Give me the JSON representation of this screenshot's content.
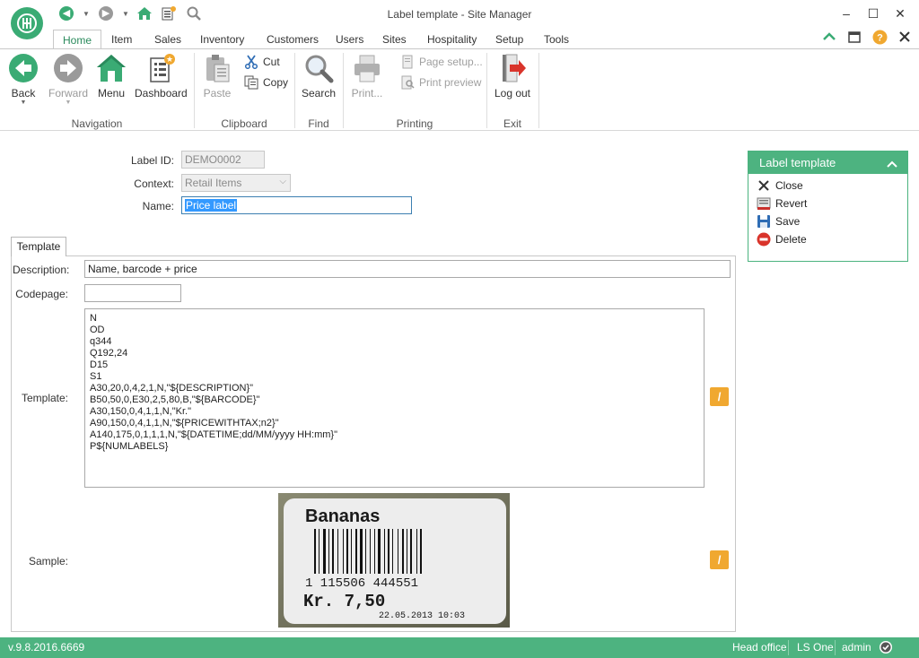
{
  "window": {
    "title": "Label template - Site Manager",
    "logo_text": "H"
  },
  "menu_tabs": [
    "Home",
    "Item",
    "Sales",
    "Inventory",
    "Customers",
    "Users",
    "Sites",
    "Hospitality",
    "Setup",
    "Tools"
  ],
  "ribbon": {
    "back": "Back",
    "forward": "Forward",
    "menu": "Menu",
    "dashboard": "Dashboard",
    "paste": "Paste",
    "cut": "Cut",
    "copy": "Copy",
    "search": "Search",
    "print": "Print...",
    "page_setup": "Page setup...",
    "print_preview": "Print preview",
    "logout": "Log out",
    "groups": {
      "navigation": "Navigation",
      "clipboard": "Clipboard",
      "find": "Find",
      "printing": "Printing",
      "exit": "Exit"
    }
  },
  "form": {
    "label_id_label": "Label ID:",
    "label_id_value": "DEMO0002",
    "context_label": "Context:",
    "context_value": "Retail Items",
    "name_label": "Name:",
    "name_value": "Price label"
  },
  "tab": {
    "label": "Template",
    "description_label": "Description:",
    "description_value": "Name, barcode + price",
    "codepage_label": "Codepage:",
    "codepage_value": "",
    "template_label": "Template:",
    "template_value": "N\nOD\nq344\nQ192,24\nD15\nS1\nA30,20,0,4,2,1,N,\"${DESCRIPTION}\"\nB50,50,0,E30,2,5,80,B,\"${BARCODE}\"\nA30,150,0,4,1,1,N,\"Kr.\"\nA90,150,0,4,1,1,N,\"${PRICEWITHTAX;n2}\"\nA140,175,0,1,1,1,N,\"${DATETIME;dd/MM/yyyy HH:mm}\"\nP${NUMLABELS}",
    "sample_label": "Sample:",
    "edit_glyph": "/"
  },
  "sample_label_image": {
    "product": "Bananas",
    "barcode_digits": "1  115506  444551",
    "price": "Kr. 7,50",
    "date": "22.05.2013 10:03"
  },
  "side_panel": {
    "title": "Label template",
    "items": [
      "Close",
      "Revert",
      "Save",
      "Delete"
    ]
  },
  "status": {
    "version": "v.9.8.2016.6669",
    "store": "Head office",
    "terminal": "LS One",
    "user": "admin"
  },
  "colors": {
    "accent": "#4db380",
    "edit_button": "#f0a830",
    "selection": "#3399ff"
  }
}
